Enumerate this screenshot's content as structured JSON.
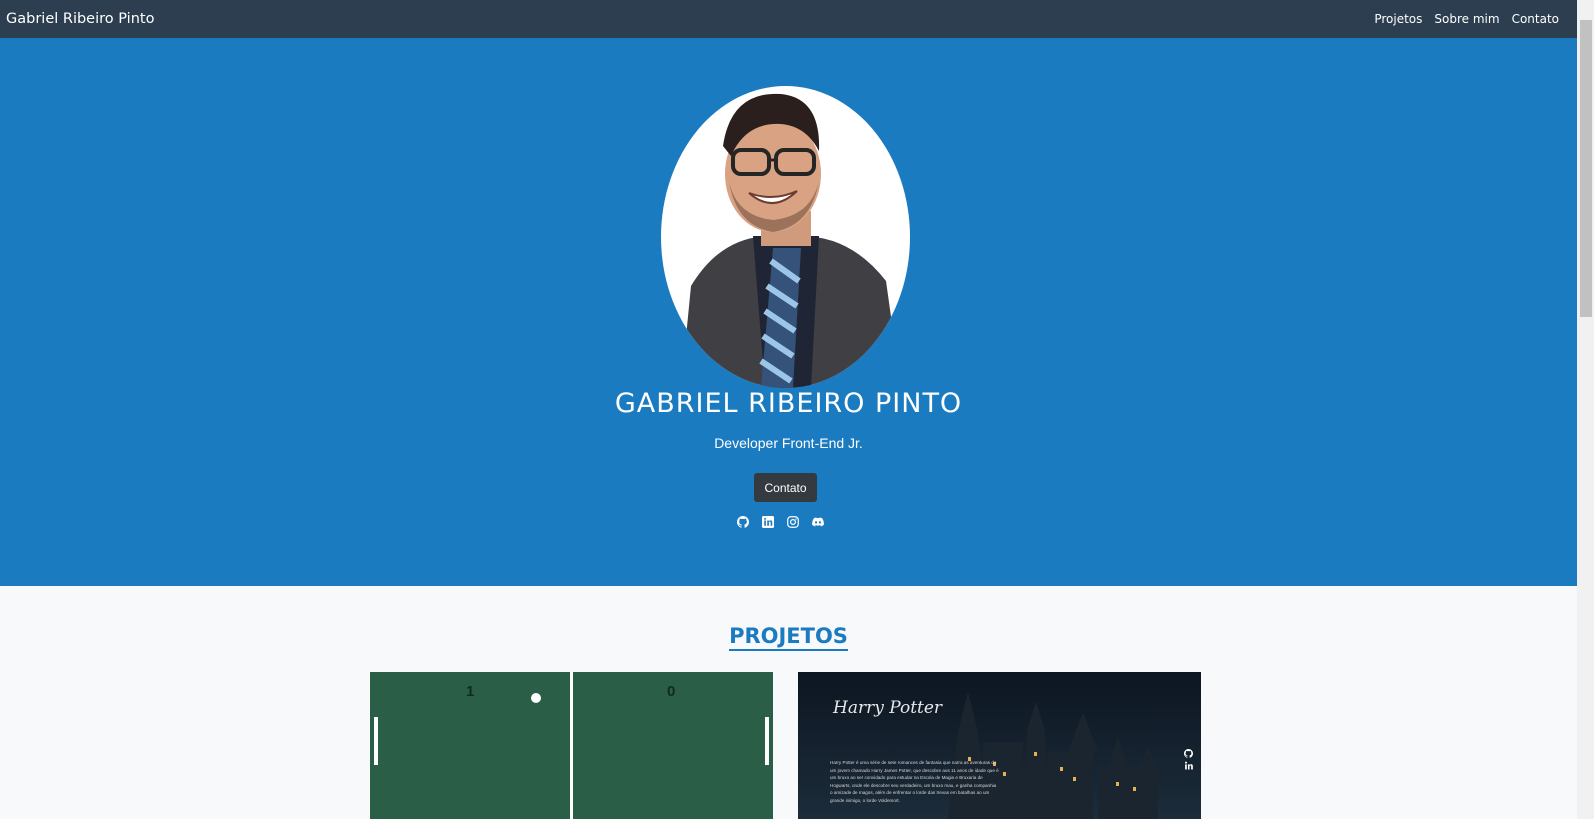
{
  "navbar": {
    "brand": "Gabriel Ribeiro Pinto",
    "links": [
      "Projetos",
      "Sobre mim",
      "Contato"
    ]
  },
  "hero": {
    "title": "GABRIEL RIBEIRO PINTO",
    "subtitle": "Developer Front-End Jr.",
    "button": "Contato",
    "socials": [
      "github-icon",
      "linkedin-icon",
      "instagram-icon",
      "discord-icon"
    ]
  },
  "projects": {
    "title": "PROJETOS",
    "pong": {
      "score_left": "1",
      "score_right": "0"
    },
    "harry_potter": {
      "logo": "Harry Potter",
      "description": "Harry Potter é uma série de sete romances de fantasia que narra as aventuras de um jovem chamado Harry James Potter, que descobre aos 11 anos de idade que é um bruxo ao ser convidado para estudar na Escola de Magia e Bruxaria de Hogwarts, onde ele descobre seu verdadeiro, um bruxo mau, e ganha companhia o amizade de magos, além de enfrentar o lorde das trevas em batalhas ao um grande inimigo, o lorde Voldemort."
    }
  },
  "colors": {
    "navbar": "#2c3e50",
    "hero": "#1a7bc0",
    "accent": "#1a7bc0",
    "button": "#343a40",
    "pong_field": "#2b5e46"
  }
}
